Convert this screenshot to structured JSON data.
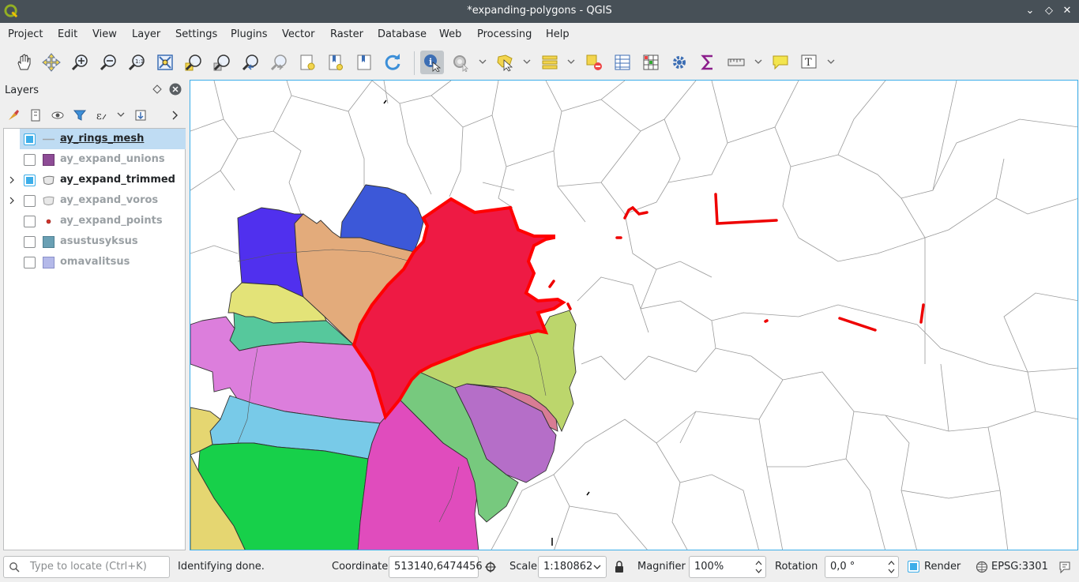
{
  "window": {
    "title": "*expanding-polygons - QGIS"
  },
  "menu": [
    "Project",
    "Edit",
    "View",
    "Layer",
    "Settings",
    "Plugins",
    "Vector",
    "Raster",
    "Database",
    "Web",
    "Processing",
    "Help"
  ],
  "toolbar": {
    "icons": [
      "pan-icon",
      "pan-to-selection-icon",
      "zoom-in-icon",
      "zoom-out-icon",
      "zoom-native-icon",
      "zoom-full-icon",
      "zoom-to-selection-icon",
      "zoom-to-layer-icon",
      "zoom-last-icon",
      "zoom-next-icon",
      "new-bookmark-icon",
      "show-bookmarks-icon",
      "new-map-view-icon",
      "refresh-icon",
      "identify-icon",
      "run-action-icon",
      "select-features-icon",
      "open-attribute-table-icon",
      "deselect-icon",
      "statistics-icon",
      "field-calculator-icon",
      "processing-toolbox-icon",
      "sum-icon",
      "measure-icon",
      "map-tips-icon",
      "text-annotation-icon"
    ]
  },
  "layers_panel": {
    "title": "Layers",
    "layers": [
      {
        "name": "ay_rings_mesh",
        "checked": true,
        "visible": true,
        "current": true,
        "expandable": false,
        "symbol": "line",
        "color": "#a0a4a8"
      },
      {
        "name": "ay_expand_unions",
        "checked": false,
        "visible": false,
        "current": false,
        "expandable": false,
        "symbol": "fill",
        "color": "#8e4c96"
      },
      {
        "name": "ay_expand_trimmed",
        "checked": true,
        "visible": true,
        "current": false,
        "expandable": true,
        "symbol": "multi",
        "color": "#cccccc"
      },
      {
        "name": "ay_expand_voros",
        "checked": false,
        "visible": false,
        "current": false,
        "expandable": true,
        "symbol": "multi",
        "color": "#cccccc"
      },
      {
        "name": "ay_expand_points",
        "checked": false,
        "visible": false,
        "current": false,
        "expandable": false,
        "symbol": "point",
        "color": "#d3332a"
      },
      {
        "name": "asustusyksus",
        "checked": false,
        "visible": false,
        "current": false,
        "expandable": false,
        "symbol": "fill",
        "color": "#6aa0b4"
      },
      {
        "name": "omavalitsus",
        "checked": false,
        "visible": false,
        "current": false,
        "expandable": false,
        "symbol": "fill",
        "color": "#b4b9e9"
      }
    ]
  },
  "status": {
    "locate_placeholder": "Type to locate (Ctrl+K)",
    "message": "Identifying done.",
    "coordinate_label": "Coordinate",
    "coordinate_value": "513140,6474456",
    "scale_label": "Scale",
    "scale_value": "1:180862",
    "magnifier_label": "Magnifier",
    "magnifier_value": "100%",
    "rotation_label": "Rotation",
    "rotation_value": "0,0 °",
    "render_label": "Render",
    "render_checked": true,
    "crs": "EPSG:3301"
  },
  "colors": {
    "accent": "#3daee9",
    "highlight_red": "#ee1144",
    "titlebar": "#475057"
  }
}
